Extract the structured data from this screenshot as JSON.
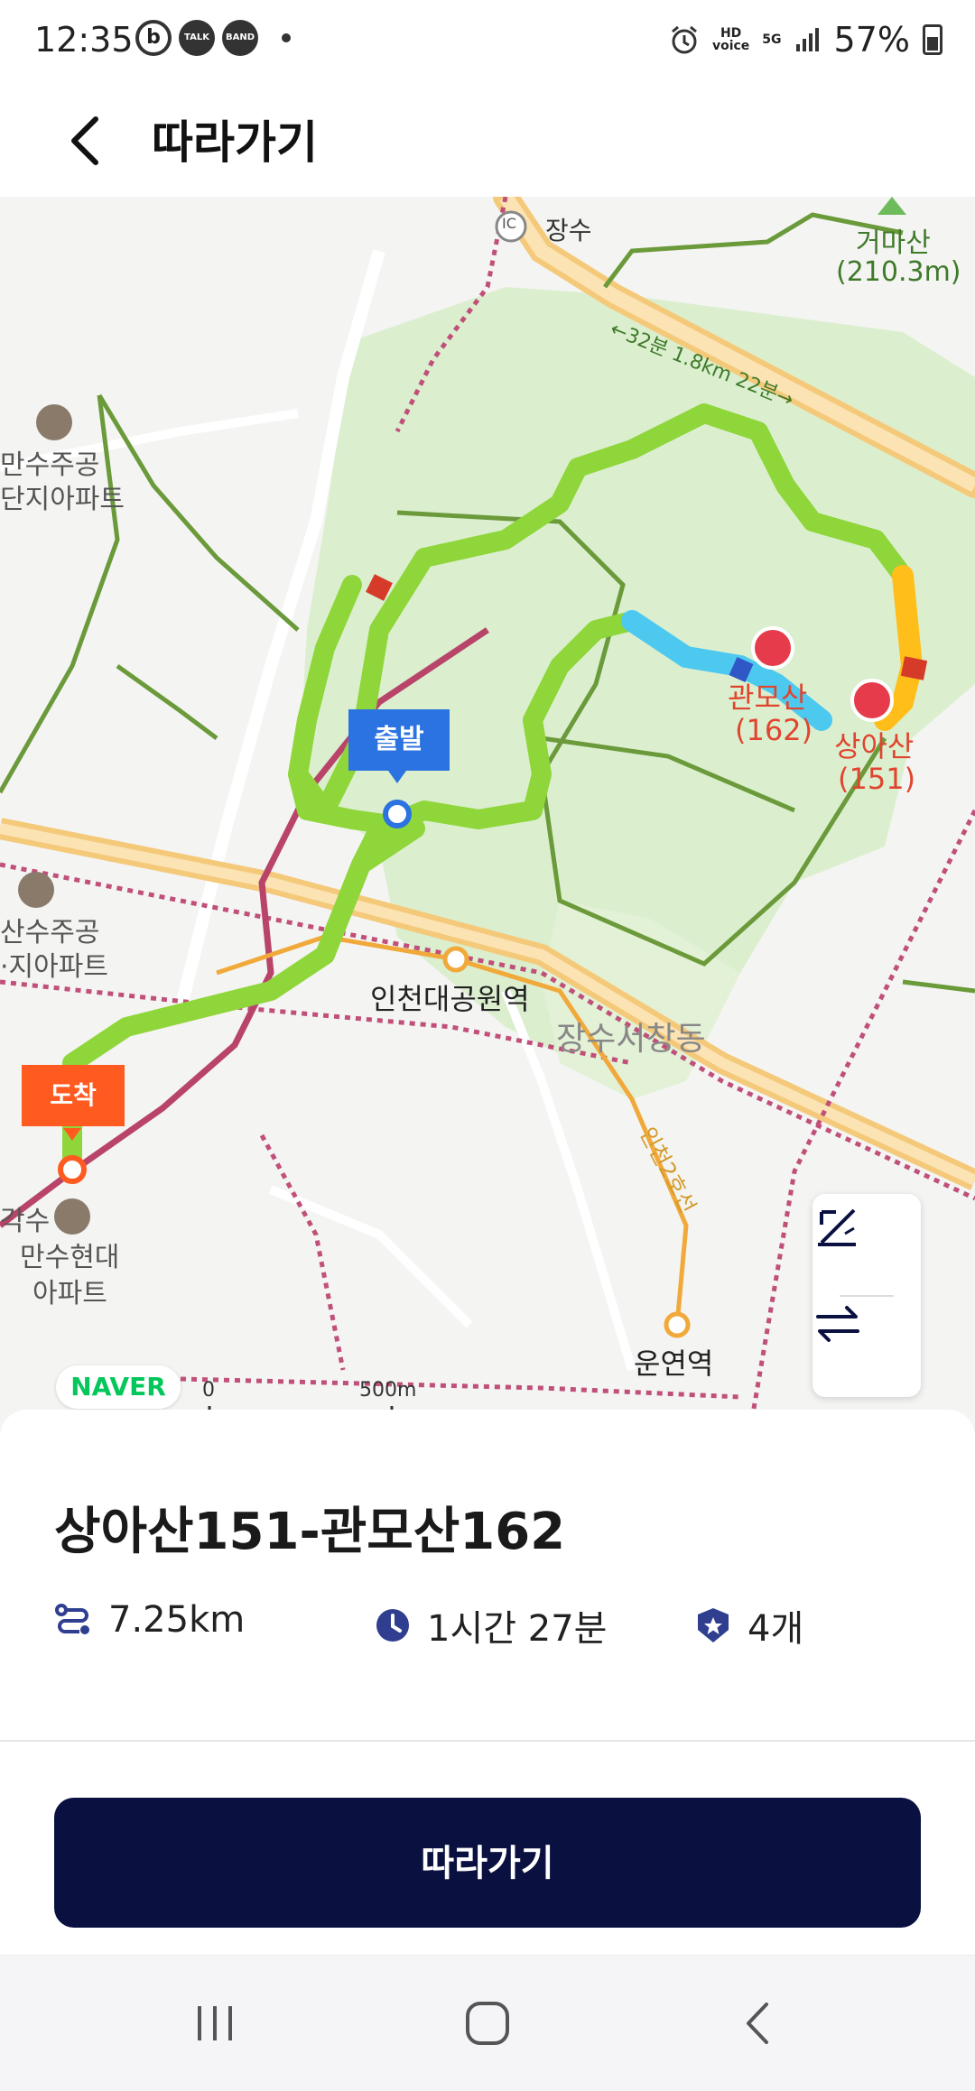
{
  "status_bar": {
    "time": "12:35",
    "app_icons": [
      "b",
      "TALK",
      "BAND"
    ],
    "hd_voice": "HD\nvoice",
    "network": "5G",
    "battery": "57%"
  },
  "header": {
    "title": "따라가기",
    "back_icon": "chevron-left-icon"
  },
  "map": {
    "labels": {
      "ic": "IC",
      "jangsu": "장수",
      "geomasan": "거마산",
      "geomasan_height": "(210.3m)",
      "trail_info": "←32분 1.8km 22분→",
      "mansu_apt_top_1": "만수주공",
      "mansu_apt_top_2": "단지아파트",
      "gwanmosan": "관모산",
      "gwanmosan_height": "(162)",
      "sangasan": "상아산",
      "sangasan_height": "(151)",
      "start": "출발",
      "mansu_apt_mid_1": "산수주공",
      "mansu_apt_mid_2": "·지아파트",
      "station_1": "인천대공원역",
      "district": "장수서창동",
      "end": "도착",
      "line2": "인천2호선",
      "mansu_hyundai_1": "만수현대",
      "mansu_hyundai_2": "아파트",
      "mansu_left": "각수",
      "station_2": "운연역",
      "naver": "NAVER",
      "scale_zero": "0",
      "scale_500": "500m"
    },
    "tools": [
      "elevation-icon",
      "swap-direction-icon"
    ]
  },
  "course": {
    "title": "상아산151-관모산162",
    "distance": "7.25km",
    "duration": "1시간 27분",
    "peaks": "4개"
  },
  "cta": {
    "follow_label": "따라가기"
  },
  "colors": {
    "route_green": "#8fd63a",
    "trail_green": "#6b9a3a",
    "park_green": "#d9eccd",
    "road_orange": "#f5c97a",
    "rail_dotted": "#c0507a",
    "start_blue": "#2b73e0",
    "end_orange": "#ff5a1f",
    "button_navy": "#0a1140"
  }
}
